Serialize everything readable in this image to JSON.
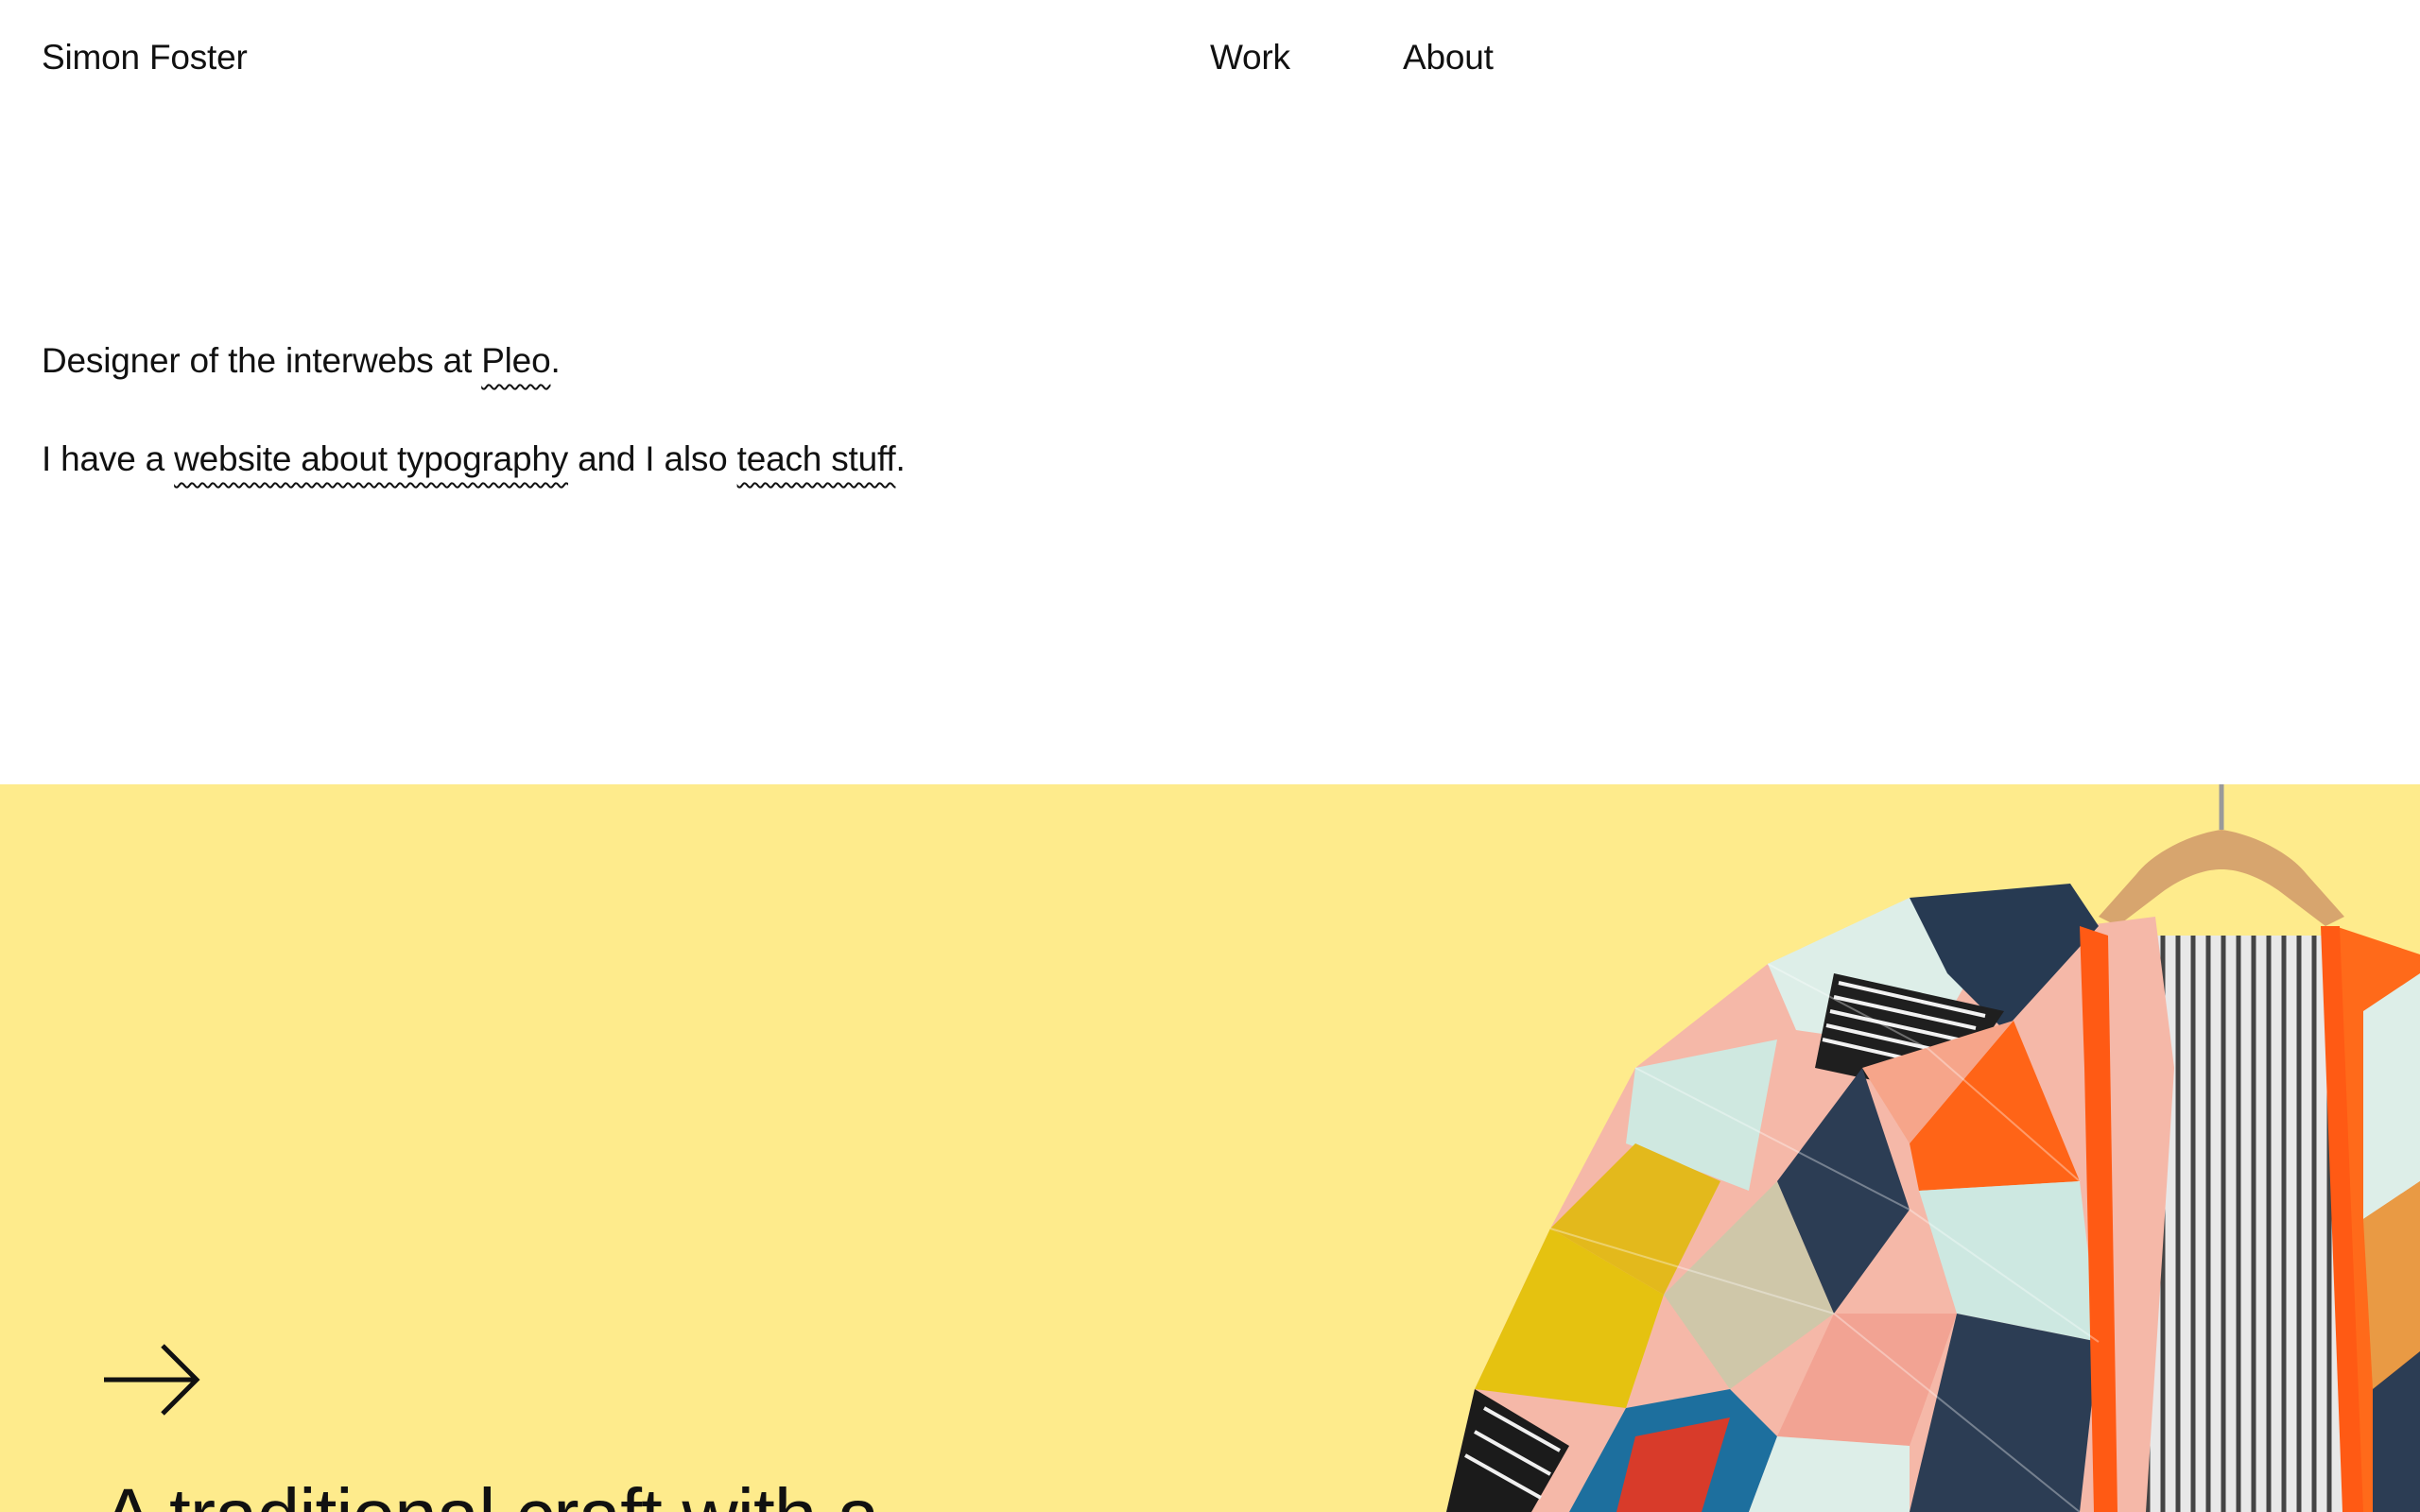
{
  "header": {
    "site_name": "Simon Foster",
    "nav": [
      {
        "label": "Work"
      },
      {
        "label": "About"
      }
    ]
  },
  "intro": {
    "line1": {
      "before": "Designer of the interwebs at ",
      "link": "Pleo",
      "after": "."
    },
    "line2": {
      "before": "I have a ",
      "link1": "website about typography",
      "middle": " and I also ",
      "link2": "teach stuff",
      "after": "."
    }
  },
  "feature": {
    "background_color": "#feeb8c",
    "arrow_icon": "arrow-right-icon",
    "title": "A traditional craft with a",
    "image_subject": "patchwork quilted jacket on a wooden hanger"
  }
}
